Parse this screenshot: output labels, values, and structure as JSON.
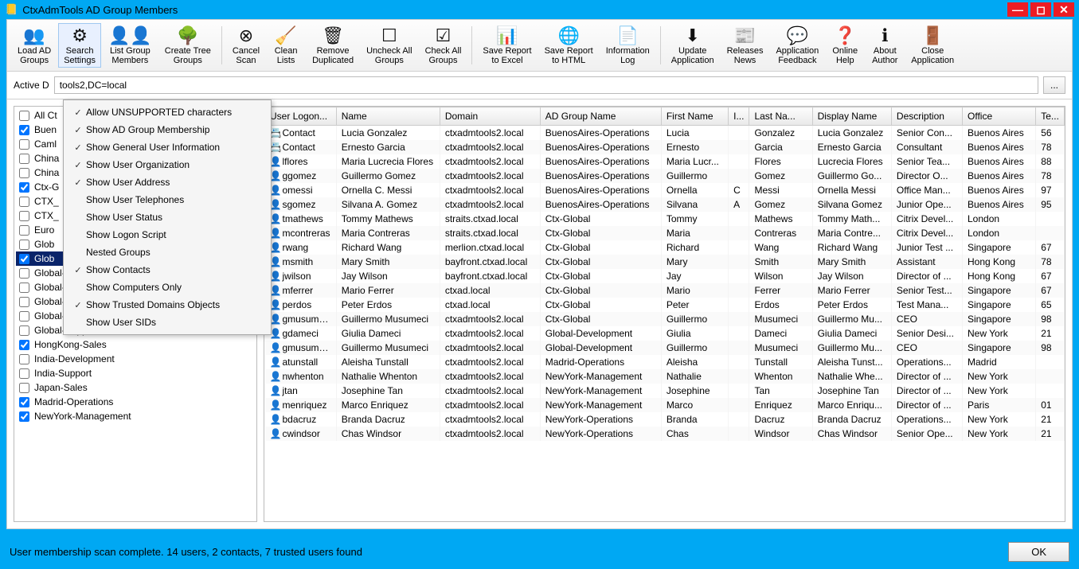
{
  "title": "CtxAdmTools AD Group Members",
  "path_label_prefix": "Active D",
  "path_value": "tools2,DC=local",
  "toolbar": [
    {
      "icon": "👥",
      "label": "Load AD\nGroups"
    },
    {
      "icon": "⚙",
      "label": "Search\nSettings",
      "active": true
    },
    {
      "icon": "👤👤",
      "label": "List Group\nMembers"
    },
    {
      "icon": "🌳",
      "label": "Create Tree\nGroups"
    },
    {
      "sep": true
    },
    {
      "icon": "⊗",
      "label": "Cancel\nScan"
    },
    {
      "icon": "🧹",
      "label": "Clean\nLists"
    },
    {
      "icon": "🗑",
      "label": "Remove\nDuplicated"
    },
    {
      "icon": "☐",
      "label": "Uncheck All\nGroups"
    },
    {
      "icon": "☑",
      "label": "Check All\nGroups"
    },
    {
      "sep": true
    },
    {
      "icon": "📊",
      "label": "Save Report\nto Excel"
    },
    {
      "icon": "🌐",
      "label": "Save Report\nto HTML"
    },
    {
      "icon": "📄",
      "label": "Information\nLog"
    },
    {
      "sep": true
    },
    {
      "icon": "⬇",
      "label": "Update\nApplication"
    },
    {
      "icon": "📰",
      "label": "Releases\nNews"
    },
    {
      "icon": "💬",
      "label": "Application\nFeedback"
    },
    {
      "icon": "❓",
      "label": "Online\nHelp"
    },
    {
      "icon": "ℹ",
      "label": "About\nAuthor"
    },
    {
      "icon": "🚪",
      "label": "Close\nApplication"
    }
  ],
  "menu": [
    {
      "checked": true,
      "label": "Allow UNSUPPORTED characters"
    },
    {
      "checked": true,
      "label": "Show AD Group Membership"
    },
    {
      "checked": true,
      "label": "Show General User Information"
    },
    {
      "checked": true,
      "label": "Show User Organization"
    },
    {
      "checked": true,
      "label": "Show User Address"
    },
    {
      "checked": false,
      "label": "Show User Telephones"
    },
    {
      "checked": false,
      "label": "Show User Status"
    },
    {
      "checked": false,
      "label": "Show Logon Script"
    },
    {
      "checked": false,
      "label": "Nested Groups"
    },
    {
      "checked": true,
      "label": "Show Contacts"
    },
    {
      "checked": false,
      "label": "Show Computers Only"
    },
    {
      "checked": true,
      "label": "Show Trusted Domains Objects"
    },
    {
      "checked": false,
      "label": "Show User SIDs"
    }
  ],
  "groups": [
    {
      "checked": false,
      "label": "All Ct",
      "sel": false
    },
    {
      "checked": true,
      "label": "Buen",
      "sel": false
    },
    {
      "checked": false,
      "label": "Caml",
      "sel": false
    },
    {
      "checked": false,
      "label": "China",
      "sel": false
    },
    {
      "checked": false,
      "label": "China",
      "sel": false
    },
    {
      "checked": true,
      "label": "Ctx-G",
      "sel": false
    },
    {
      "checked": false,
      "label": "CTX_",
      "sel": false
    },
    {
      "checked": false,
      "label": "CTX_",
      "sel": false
    },
    {
      "checked": false,
      "label": "Euro",
      "sel": false
    },
    {
      "checked": false,
      "label": "Glob",
      "sel": false
    },
    {
      "checked": true,
      "label": "Glob",
      "sel": true
    },
    {
      "checked": false,
      "label": "Global-Financial",
      "sel": false
    },
    {
      "checked": false,
      "label": "Global-Management",
      "sel": false
    },
    {
      "checked": false,
      "label": "Global-Operations",
      "sel": false
    },
    {
      "checked": false,
      "label": "Global-Sales",
      "sel": false
    },
    {
      "checked": false,
      "label": "Global-Support",
      "sel": false
    },
    {
      "checked": true,
      "label": "HongKong-Sales",
      "sel": false
    },
    {
      "checked": false,
      "label": "India-Development",
      "sel": false
    },
    {
      "checked": false,
      "label": "India-Support",
      "sel": false
    },
    {
      "checked": false,
      "label": "Japan-Sales",
      "sel": false
    },
    {
      "checked": true,
      "label": "Madrid-Operations",
      "sel": false
    },
    {
      "checked": true,
      "label": "NewYork-Management",
      "sel": false
    }
  ],
  "columns": [
    "User Logon...",
    "Name",
    "Domain",
    "AD Group Name",
    "First Name",
    "I...",
    "Last Na...",
    "Display Name",
    "Description",
    "Office",
    "Te..."
  ],
  "rows": [
    {
      "icon": "contact",
      "cells": [
        "Contact",
        "Lucia Gonzalez",
        "ctxadmtools2.local",
        "BuenosAires-Operations",
        "Lucia",
        "",
        "Gonzalez",
        "Lucia Gonzalez",
        "Senior Con...",
        "Buenos Aires",
        "56"
      ]
    },
    {
      "icon": "contact",
      "cells": [
        "Contact",
        "Ernesto Garcia",
        "ctxadmtools2.local",
        "BuenosAires-Operations",
        "Ernesto",
        "",
        "Garcia",
        "Ernesto Garcia",
        "Consultant",
        "Buenos Aires",
        "78"
      ]
    },
    {
      "icon": "user",
      "cells": [
        "lflores",
        "Maria Lucrecia Flores",
        "ctxadmtools2.local",
        "BuenosAires-Operations",
        "Maria Lucr...",
        "",
        "Flores",
        "Lucrecia Flores",
        "Senior Tea...",
        "Buenos Aires",
        "88"
      ]
    },
    {
      "icon": "user",
      "cells": [
        "ggomez",
        "Guillermo Gomez",
        "ctxadmtools2.local",
        "BuenosAires-Operations",
        "Guillermo",
        "",
        "Gomez",
        "Guillermo Go...",
        "Director O...",
        "Buenos Aires",
        "78"
      ]
    },
    {
      "icon": "user",
      "cells": [
        "omessi",
        "Ornella C. Messi",
        "ctxadmtools2.local",
        "BuenosAires-Operations",
        "Ornella",
        "C",
        "Messi",
        "Ornella Messi",
        "Office Man...",
        "Buenos Aires",
        "97"
      ]
    },
    {
      "icon": "user",
      "cells": [
        "sgomez",
        "Silvana A. Gomez",
        "ctxadmtools2.local",
        "BuenosAires-Operations",
        "Silvana",
        "A",
        "Gomez",
        "Silvana Gomez",
        "Junior Ope...",
        "Buenos Aires",
        "95"
      ]
    },
    {
      "icon": "trust",
      "cells": [
        "tmathews",
        "Tommy Mathews",
        "straits.ctxad.local",
        "Ctx-Global",
        "Tommy",
        "",
        "Mathews",
        "Tommy Math...",
        "Citrix Devel...",
        "London",
        ""
      ]
    },
    {
      "icon": "trust",
      "cells": [
        "mcontreras",
        "Maria Contreras",
        "straits.ctxad.local",
        "Ctx-Global",
        "Maria",
        "",
        "Contreras",
        "Maria Contre...",
        "Citrix Devel...",
        "London",
        ""
      ]
    },
    {
      "icon": "trust",
      "cells": [
        "rwang",
        "Richard Wang",
        "merlion.ctxad.local",
        "Ctx-Global",
        "Richard",
        "",
        "Wang",
        "Richard Wang",
        "Junior Test ...",
        "Singapore",
        "67"
      ]
    },
    {
      "icon": "trust",
      "cells": [
        "msmith",
        "Mary Smith",
        "bayfront.ctxad.local",
        "Ctx-Global",
        "Mary",
        "",
        "Smith",
        "Mary Smith",
        "Assistant",
        "Hong Kong",
        "78"
      ]
    },
    {
      "icon": "trust",
      "cells": [
        "jwilson",
        "Jay Wilson",
        "bayfront.ctxad.local",
        "Ctx-Global",
        "Jay",
        "",
        "Wilson",
        "Jay Wilson",
        "Director of ...",
        "Hong Kong",
        "67"
      ]
    },
    {
      "icon": "trust",
      "cells": [
        "mferrer",
        "Mario Ferrer",
        "ctxad.local",
        "Ctx-Global",
        "Mario",
        "",
        "Ferrer",
        "Mario Ferrer",
        "Senior Test...",
        "Singapore",
        "67"
      ]
    },
    {
      "icon": "trust",
      "cells": [
        "perdos",
        "Peter Erdos",
        "ctxad.local",
        "Ctx-Global",
        "Peter",
        "",
        "Erdos",
        "Peter Erdos",
        "Test Mana...",
        "Singapore",
        "65"
      ]
    },
    {
      "icon": "user",
      "cells": [
        "gmusumeci",
        "Guillermo Musumeci",
        "ctxadmtools2.local",
        "Ctx-Global",
        "Guillermo",
        "",
        "Musumeci",
        "Guillermo Mu...",
        "CEO",
        "Singapore",
        "98"
      ]
    },
    {
      "icon": "user",
      "cells": [
        "gdameci",
        "Giulia Dameci",
        "ctxadmtools2.local",
        "Global-Development",
        "Giulia",
        "",
        "Dameci",
        "Giulia Dameci",
        "Senior Desi...",
        "New York",
        "21"
      ]
    },
    {
      "icon": "user",
      "cells": [
        "gmusumeci",
        "Guillermo Musumeci",
        "ctxadmtools2.local",
        "Global-Development",
        "Guillermo",
        "",
        "Musumeci",
        "Guillermo Mu...",
        "CEO",
        "Singapore",
        "98"
      ]
    },
    {
      "icon": "user",
      "cells": [
        "atunstall",
        "Aleisha Tunstall",
        "ctxadmtools2.local",
        "Madrid-Operations",
        "Aleisha",
        "",
        "Tunstall",
        "Aleisha Tunst...",
        "Operations...",
        "Madrid",
        ""
      ]
    },
    {
      "icon": "user",
      "cells": [
        "nwhenton",
        "Nathalie Whenton",
        "ctxadmtools2.local",
        "NewYork-Management",
        "Nathalie",
        "",
        "Whenton",
        "Nathalie Whe...",
        "Director of ...",
        "New York",
        ""
      ]
    },
    {
      "icon": "user",
      "cells": [
        "jtan",
        "Josephine Tan",
        "ctxadmtools2.local",
        "NewYork-Management",
        "Josephine",
        "",
        "Tan",
        "Josephine Tan",
        "Director of ...",
        "New York",
        ""
      ]
    },
    {
      "icon": "user",
      "cells": [
        "menriquez",
        "Marco Enriquez",
        "ctxadmtools2.local",
        "NewYork-Management",
        "Marco",
        "",
        "Enriquez",
        "Marco Enriqu...",
        "Director of ...",
        "Paris",
        "01"
      ]
    },
    {
      "icon": "user",
      "cells": [
        "bdacruz",
        "Branda Dacruz",
        "ctxadmtools2.local",
        "NewYork-Operations",
        "Branda",
        "",
        "Dacruz",
        "Branda Dacruz",
        "Operations...",
        "New York",
        "21"
      ]
    },
    {
      "icon": "user",
      "cells": [
        "cwindsor",
        "Chas Windsor",
        "ctxadmtools2.local",
        "NewYork-Operations",
        "Chas",
        "",
        "Windsor",
        "Chas Windsor",
        "Senior Ope...",
        "New York",
        "21"
      ]
    }
  ],
  "status": "User membership scan complete. 14 users, 2 contacts, 7 trusted users found",
  "ok_label": "OK"
}
